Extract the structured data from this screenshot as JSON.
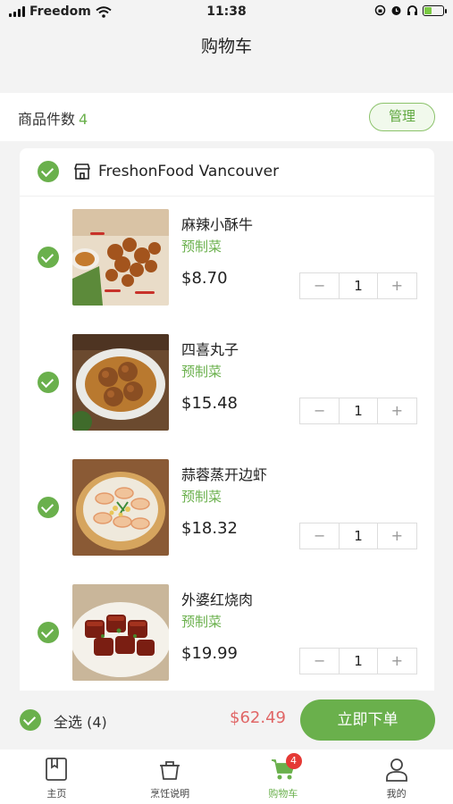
{
  "status_bar": {
    "carrier": "Freedom",
    "time": "11:38"
  },
  "header": {
    "title": "购物车"
  },
  "count_bar": {
    "label": "商品件数",
    "count": "4",
    "manage_label": "管理"
  },
  "store": {
    "name": "FreshonFood Vancouver"
  },
  "items": [
    {
      "name": "麻辣小酥牛",
      "tag": "预制菜",
      "price": "$8.70",
      "qty": "1"
    },
    {
      "name": "四喜丸子",
      "tag": "预制菜",
      "price": "$15.48",
      "qty": "1"
    },
    {
      "name": "蒜蓉蒸开边虾",
      "tag": "预制菜",
      "price": "$18.32",
      "qty": "1"
    },
    {
      "name": "外婆红烧肉",
      "tag": "预制菜",
      "price": "$19.99",
      "qty": "1"
    }
  ],
  "stepper": {
    "minus": "−",
    "plus": "+"
  },
  "checkout": {
    "select_all_label": "全选 (4)",
    "total": "$62.49",
    "order_label": "立即下单"
  },
  "tabbar": {
    "tabs": [
      {
        "label": "主页",
        "icon": "home-book-icon"
      },
      {
        "label": "烹饪说明",
        "icon": "cooking-pot-icon"
      },
      {
        "label": "购物车",
        "icon": "cart-icon",
        "badge": "4"
      },
      {
        "label": "我的",
        "icon": "user-icon"
      }
    ]
  },
  "colors": {
    "accent": "#6ab04c",
    "price_total": "#e06666",
    "badge": "#e53935"
  }
}
